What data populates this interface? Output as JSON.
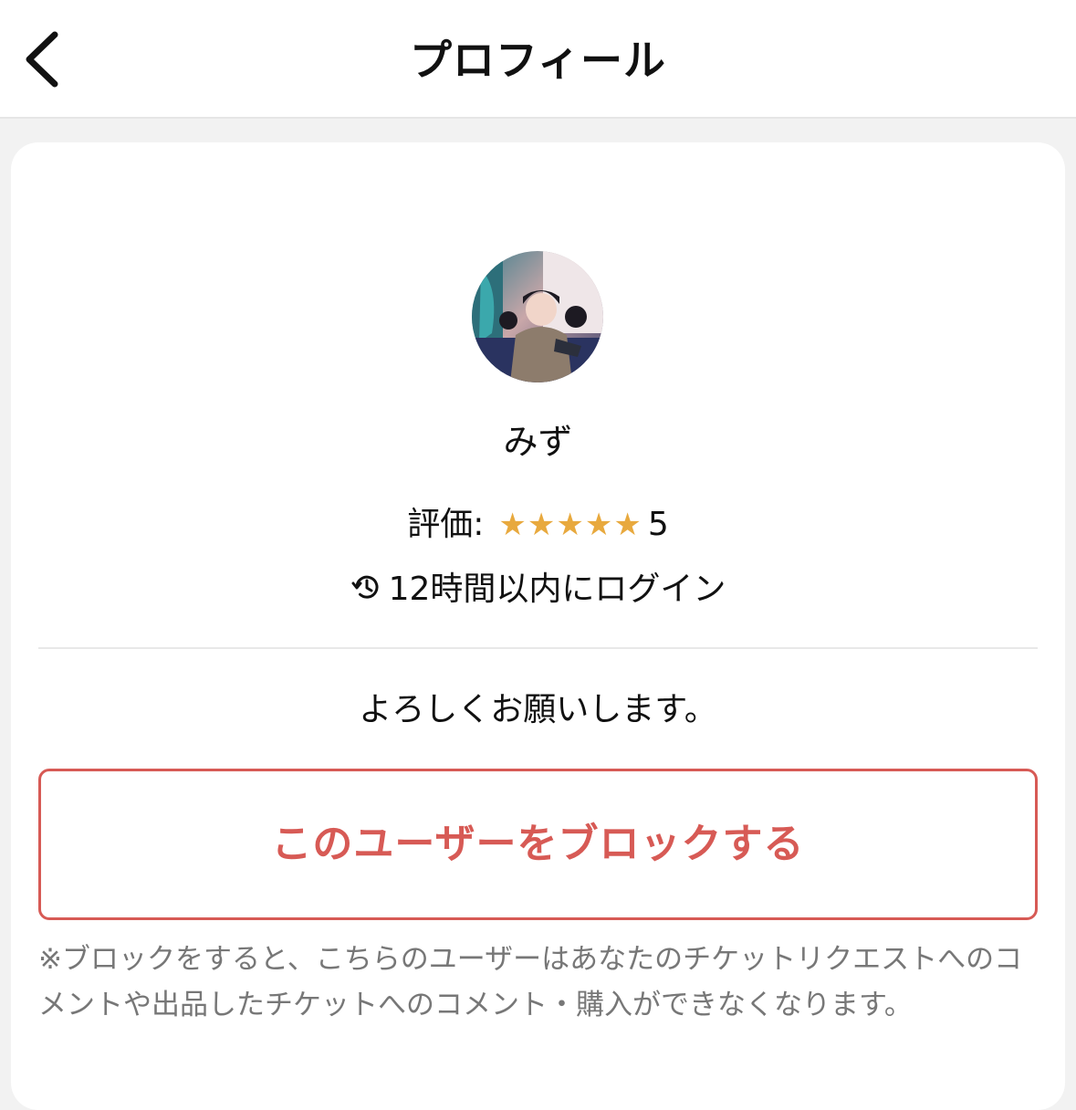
{
  "header": {
    "title": "プロフィール"
  },
  "profile": {
    "username": "みず",
    "rating_label": "評価:",
    "rating_stars": "★★★★★",
    "rating_value": "5",
    "last_login": "12時間以内にログイン",
    "bio": "よろしくお願いします。"
  },
  "actions": {
    "block_label": "このユーザーをブロックする",
    "block_note": "※ブロックをすると、こちらのユーザーはあなたのチケットリクエストへのコメントや出品したチケットへのコメント・購入ができなくなります。"
  },
  "colors": {
    "star": "#e8a93e",
    "block_red": "#d75a55",
    "note_gray": "#777777"
  },
  "icons": {
    "back": "chevron-left-icon",
    "login": "history-icon"
  }
}
